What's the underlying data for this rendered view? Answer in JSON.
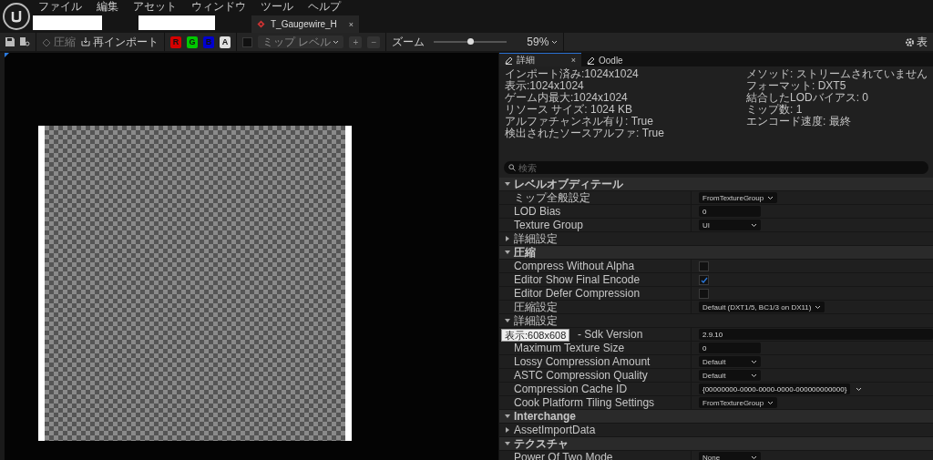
{
  "menu": [
    "ファイル",
    "編集",
    "アセット",
    "ウィンドウ",
    "ツール",
    "ヘルプ"
  ],
  "document_tab": {
    "title": "T_Gaugewire_H",
    "close": "×"
  },
  "toolbar": {
    "compress": {
      "label": "圧縮",
      "disabled": true
    },
    "reimport": {
      "label": "再インポート",
      "disabled": false
    },
    "channels": [
      {
        "label": "R",
        "on": true,
        "color": "#d40000"
      },
      {
        "label": "G",
        "on": true,
        "color": "#00c800"
      },
      {
        "label": "B",
        "on": true,
        "color": "#0000d0"
      },
      {
        "label": "A",
        "on": true,
        "color": "#e0e0e0"
      }
    ],
    "mip_checkbox": {
      "checked": false
    },
    "mip_level": {
      "label": "ミップ レベル",
      "disabled": true
    },
    "plus": "+",
    "minus": "−",
    "zoom": {
      "label": "ズーム",
      "level": 0.5,
      "reading": "59%"
    },
    "settings_label": "表"
  },
  "panel_tabs": [
    {
      "label": "詳細",
      "selected": true,
      "close": "×"
    },
    {
      "label": "Oodle",
      "selected": false
    }
  ],
  "info": {
    "left": [
      "インポート済み:1024x1024",
      "表示:1024x1024",
      "ゲーム内最大:1024x1024",
      "リソース サイズ: 1024 KB",
      "アルファチャンネル有り: True",
      "検出されたソースアルファ: True"
    ],
    "right": [
      "メソッド: ストリームされていません",
      "フォーマット: DXT5",
      "結合したLODバイアス: 0",
      "ミップ数: 1",
      "エンコード速度: 最終"
    ]
  },
  "search": {
    "placeholder": "検索"
  },
  "properties": [
    {
      "kind": "category",
      "label": "レベルオブディテール",
      "expanded": true
    },
    {
      "kind": "dropdown",
      "label": "ミップ全般設定",
      "value": "FromTextureGroup"
    },
    {
      "kind": "number",
      "label": "LOD Bias",
      "value": "0"
    },
    {
      "kind": "dropdown",
      "label": "Texture Group",
      "value": "UI"
    },
    {
      "kind": "group",
      "label": "詳細設定",
      "expanded": false
    },
    {
      "kind": "category",
      "label": "圧縮",
      "expanded": true
    },
    {
      "kind": "checkbox",
      "label": "Compress Without Alpha",
      "checked": false
    },
    {
      "kind": "checkbox",
      "label": "Editor Show Final Encode",
      "checked": true
    },
    {
      "kind": "checkbox",
      "label": "Editor Defer Compression",
      "checked": false
    },
    {
      "kind": "dropdown",
      "label": "圧縮設定",
      "value": "Default (DXT1/5, BC1/3 on DX11)"
    },
    {
      "kind": "group",
      "label": "詳細設定",
      "expanded": true
    },
    {
      "kind": "text",
      "label": "- Sdk Version",
      "value": "2.9.10"
    },
    {
      "kind": "number",
      "label": "Maximum Texture Size",
      "value": "0"
    },
    {
      "kind": "dropdown",
      "label": "Lossy Compression Amount",
      "value": "Default"
    },
    {
      "kind": "dropdown",
      "label": "ASTC Compression Quality",
      "value": "Default"
    },
    {
      "kind": "guid",
      "label": "Compression Cache ID",
      "value": "{00000000-0000-0000-0000-000000000000}"
    },
    {
      "kind": "dropdown",
      "label": "Cook Platform Tiling Settings",
      "value": "FromTextureGroup"
    },
    {
      "kind": "category",
      "label": "Interchange",
      "expanded": true
    },
    {
      "kind": "group",
      "label": "AssetImportData",
      "expanded": false
    },
    {
      "kind": "category",
      "label": "テクスチャ",
      "expanded": true
    },
    {
      "kind": "dropdown",
      "label": "Power Of Two Mode",
      "value": "None"
    }
  ],
  "tooltip": "表示:608x608"
}
